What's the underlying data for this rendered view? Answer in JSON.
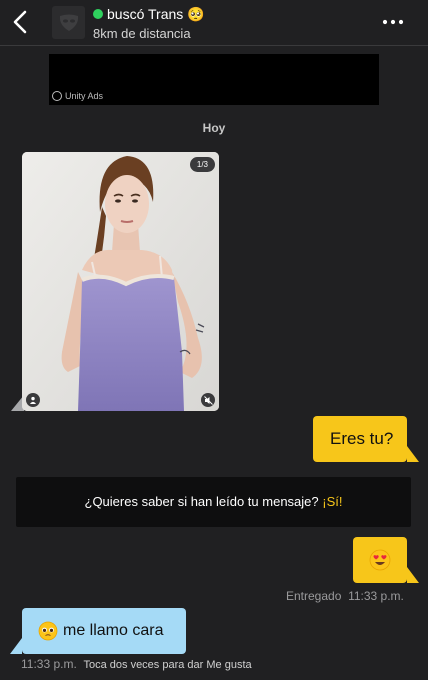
{
  "header": {
    "username": "buscó Trans 🥺",
    "distance": "8km de distancia"
  },
  "ad": {
    "brand": "Unity Ads"
  },
  "thread": {
    "day_label": "Hoy"
  },
  "photo": {
    "counter": "1/3"
  },
  "messages": {
    "sent_1": "Eres tu?",
    "sent_2_emoji": "heart-eyes",
    "received_1": "me llamo cara"
  },
  "read_banner": {
    "question": "¿Quieres saber si han leído tu mensaje?",
    "cta": "¡Sí!"
  },
  "delivery": {
    "status": "Entregado",
    "time": "11:33 p.m."
  },
  "received_meta": {
    "time": "11:33 p.m.",
    "hint": "Toca dos veces para dar Me gusta"
  },
  "colors": {
    "background": "#202022",
    "outgoing_bubble": "#f7c61a",
    "incoming_bubble": "#a5daf6",
    "online": "#2fd15e"
  }
}
